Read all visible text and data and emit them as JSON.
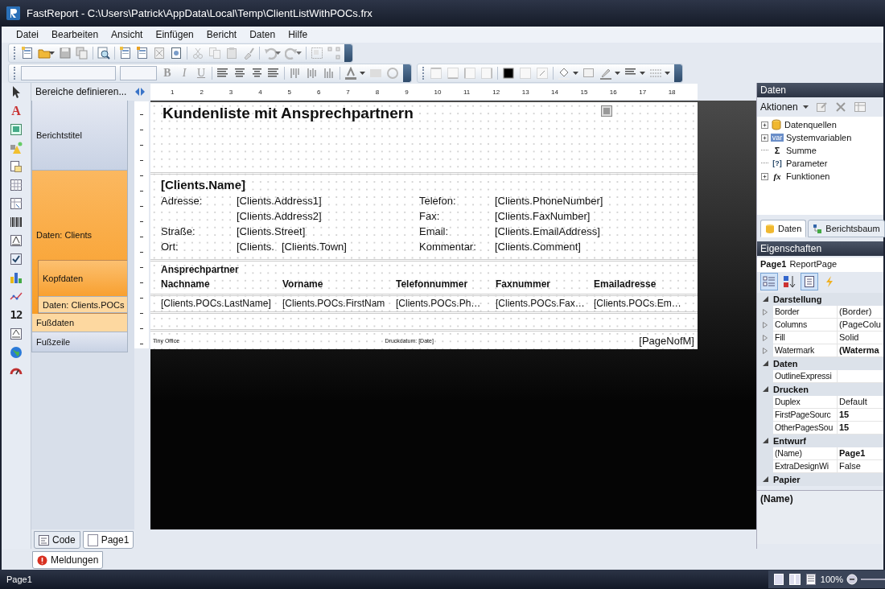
{
  "window": {
    "title": "FastReport - C:\\Users\\Patrick\\AppData\\Local\\Temp\\ClientListWithPOCs.frx"
  },
  "menu": [
    "Datei",
    "Bearbeiten",
    "Ansicht",
    "Einfügen",
    "Bericht",
    "Daten",
    "Hilfe"
  ],
  "format_buttons": [
    "B",
    "I",
    "U"
  ],
  "toolbox": [
    {
      "kind": "pointer"
    },
    {
      "kind": "text",
      "glyph": "A"
    },
    {
      "kind": "picture"
    },
    {
      "kind": "shapes"
    },
    {
      "kind": "subreport"
    },
    {
      "kind": "table"
    },
    {
      "kind": "matrix"
    },
    {
      "kind": "barcode"
    },
    {
      "kind": "richtext"
    },
    {
      "kind": "checkbox"
    },
    {
      "kind": "chart"
    },
    {
      "kind": "sparkline"
    },
    {
      "kind": "digits",
      "glyph": "12"
    },
    {
      "kind": "zipcode"
    },
    {
      "kind": "globe"
    },
    {
      "kind": "gauge"
    }
  ],
  "bands_panel": {
    "button": "Bereiche definieren...",
    "bands": [
      {
        "label": "Berichtstitel",
        "kind": "title"
      },
      {
        "label": "Daten: Clients",
        "kind": "data",
        "children": [
          {
            "label": "Kopfdaten",
            "kind": "header"
          },
          {
            "label": "Daten: Clients.POCs",
            "kind": "subdata"
          },
          {
            "label": "Fußdaten",
            "kind": "footer"
          }
        ]
      },
      {
        "label": "Fußzeile",
        "kind": "pagefooter"
      }
    ]
  },
  "ruler": [
    "1",
    "2",
    "3",
    "4",
    "5",
    "6",
    "7",
    "8",
    "9",
    "10",
    "11",
    "12",
    "13",
    "14",
    "15",
    "16",
    "17",
    "18"
  ],
  "report": {
    "title": "Kundenliste mit Ansprechpartnern",
    "client_heading": "[Clients.Name]",
    "client_rows": [
      {
        "label": "Adresse:",
        "values": [
          "[Clients.Address1]"
        ],
        "label_2": "Telefon:",
        "value_2": "[Clients.PhoneNumber]"
      },
      {
        "values": [
          "[Clients.Address2]"
        ],
        "label_2": "Fax:",
        "value_2": "[Clients.FaxNumber]"
      },
      {
        "label": "Straße:",
        "values": [
          "[Clients.Street]"
        ],
        "label_2": "Email:",
        "value_2": "[Clients.EmailAddress]"
      },
      {
        "label": "Ort:",
        "values": [
          "[Clients.",
          "[Clients.Town]"
        ],
        "label_2": "Kommentar:",
        "value_2": "[Clients.Comment]"
      }
    ],
    "poc_heading": "Ansprechpartner",
    "poc_columns": [
      "Nachname",
      "Vorname",
      "Telefonnummer",
      "Faxnummer",
      "Emailadresse"
    ],
    "poc_cells": [
      "[Clients.POCs.LastName]",
      "[Clients.POCs.FirstNam",
      "[Clients.POCs.Ph…",
      "[Clients.POCs.Fax…",
      "[Clients.POCs.Em…"
    ],
    "footer_left": "Tiny Office",
    "footer_center": "Druckdatum: [Date]",
    "footer_right": "[PageNofM]"
  },
  "data_panel": {
    "title": "Daten",
    "actions": "Aktionen",
    "tree": [
      {
        "label": "Datenquellen",
        "kind": "datasource",
        "expandable": true
      },
      {
        "label": "Systemvariablen",
        "kind": "variables",
        "glyph": "var",
        "expandable": true
      },
      {
        "label": "Summe",
        "kind": "total",
        "glyph": "Σ",
        "expandable": false
      },
      {
        "label": "Parameter",
        "kind": "parameter",
        "glyph": "[?]",
        "expandable": false
      },
      {
        "label": "Funktionen",
        "kind": "function",
        "glyph": "fx",
        "expandable": true
      }
    ],
    "tabs": [
      {
        "label": "Daten",
        "kind": "data",
        "selected": true
      },
      {
        "label": "Berichtsbaum",
        "kind": "tree",
        "selected": false
      }
    ]
  },
  "properties": {
    "title": "Eigenschaften",
    "object_name": "Page1",
    "object_type": "ReportPage",
    "toolbar": [
      {
        "kind": "categorized",
        "selected": true
      },
      {
        "kind": "alphabetical",
        "selected": false
      },
      {
        "kind": "properties",
        "selected": true
      },
      {
        "kind": "events",
        "selected": false
      }
    ],
    "categories": [
      {
        "name": "Darstellung",
        "expanded": true,
        "rows": [
          {
            "name": "Border",
            "value": "(Border)",
            "expandable": true,
            "bold": false
          },
          {
            "name": "Columns",
            "value": "(PageColu",
            "expandable": true,
            "bold": false
          },
          {
            "name": "Fill",
            "value": "Solid",
            "expandable": true,
            "bold": false
          },
          {
            "name": "Watermark",
            "value": "(Waterma",
            "expandable": true,
            "bold": true
          }
        ]
      },
      {
        "name": "Daten",
        "expanded": true,
        "rows": [
          {
            "name": "OutlineExpressi",
            "expandable": false,
            "bold": false
          }
        ]
      },
      {
        "name": "Drucken",
        "expanded": true,
        "rows": [
          {
            "name": "Duplex",
            "value": "Default",
            "expandable": false,
            "bold": false
          },
          {
            "name": "FirstPageSourc",
            "value": "15",
            "expandable": false,
            "bold": true
          },
          {
            "name": "OtherPagesSou",
            "value": "15",
            "expandable": false,
            "bold": true
          }
        ]
      },
      {
        "name": "Entwurf",
        "expanded": true,
        "rows": [
          {
            "name": "(Name)",
            "value": "Page1",
            "expandable": false,
            "bold": true
          },
          {
            "name": "ExtraDesignWi",
            "value": "False",
            "expandable": false,
            "bold": false
          }
        ]
      },
      {
        "name": "Papier",
        "expanded": true
      }
    ],
    "description": "(Name)"
  },
  "page_tabs": [
    {
      "label": "Code",
      "kind": "code",
      "selected": false
    },
    {
      "label": "Page1",
      "kind": "page",
      "selected": true
    }
  ],
  "messages_tab": "Meldungen",
  "status": {
    "text": "Page1",
    "zoom": "100%"
  }
}
